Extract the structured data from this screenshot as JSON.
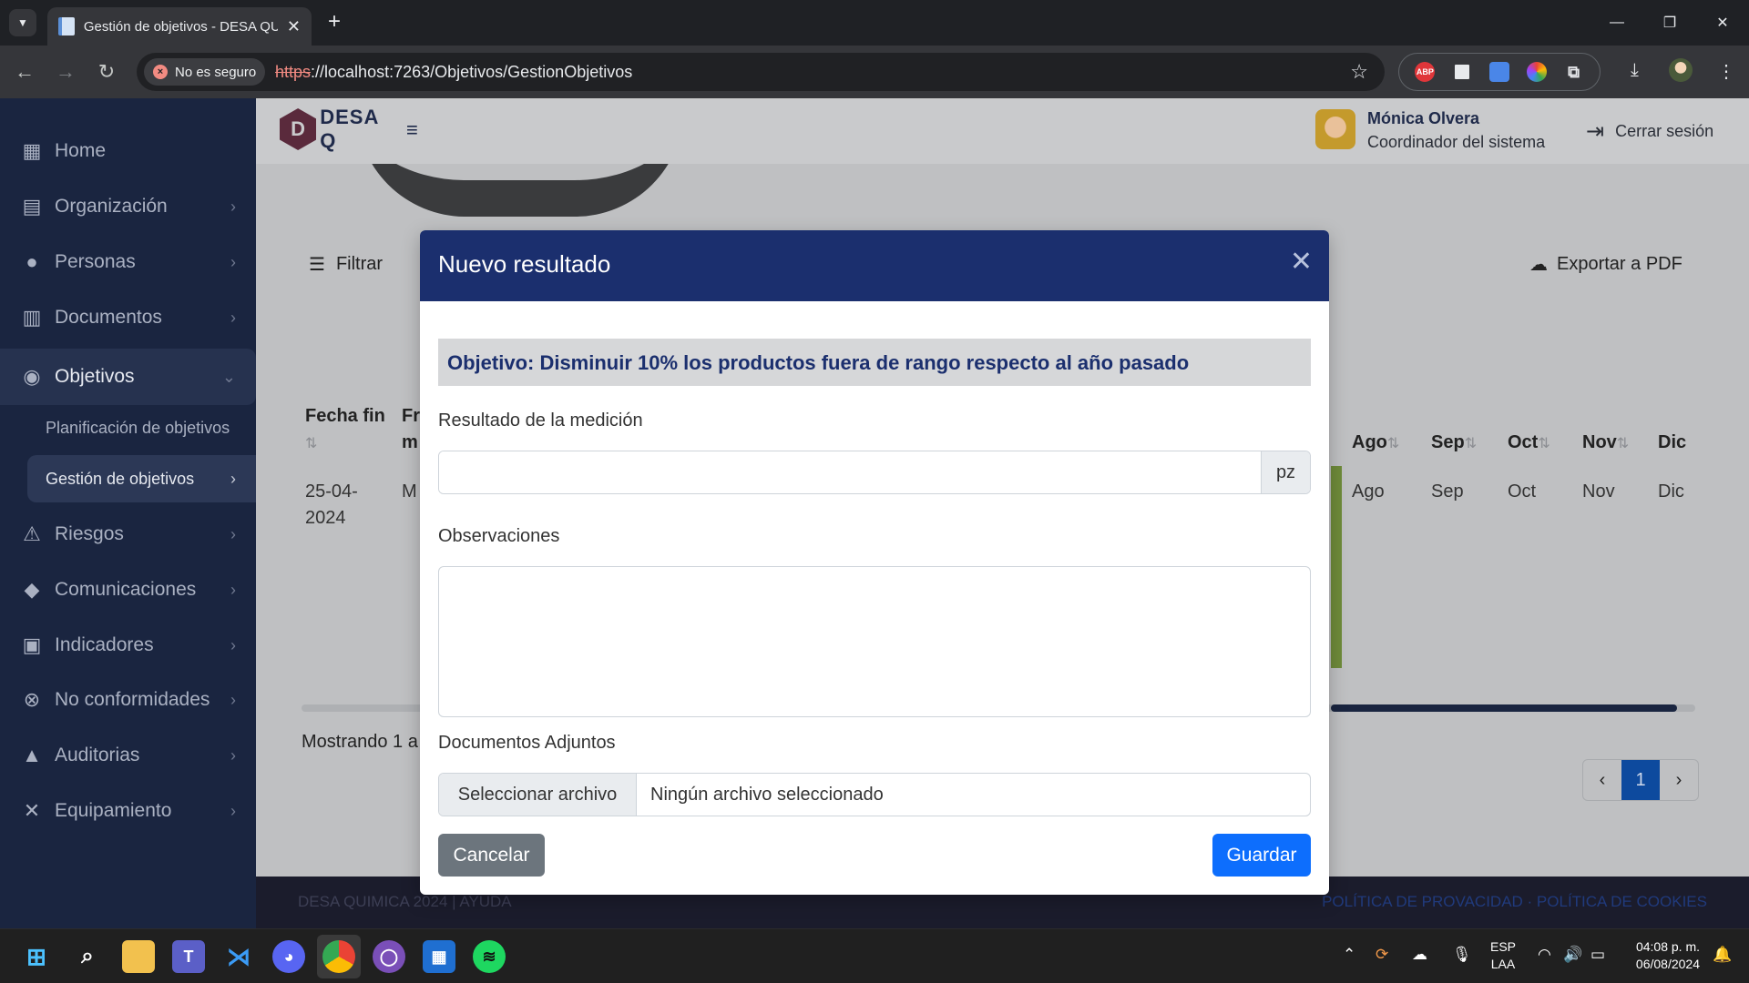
{
  "browser": {
    "tab_title": "Gestión de objetivos - DESA QU",
    "security_chip": "No es seguro",
    "url_scheme": "https",
    "url_rest": "://localhost:7263/Objetivos/GestionObjetivos",
    "extensions": [
      "ABP",
      "reader",
      "docs",
      "color",
      "puzzle"
    ]
  },
  "sidebar": {
    "items": [
      {
        "label": "Home",
        "icon": "dashboard-icon"
      },
      {
        "label": "Organización",
        "icon": "building-icon"
      },
      {
        "label": "Personas",
        "icon": "person-icon"
      },
      {
        "label": "Documentos",
        "icon": "book-icon"
      },
      {
        "label": "Objetivos",
        "icon": "target-icon"
      },
      {
        "label": "Riesgos",
        "icon": "warning-icon"
      },
      {
        "label": "Comunicaciones",
        "icon": "chat-icon"
      },
      {
        "label": "Indicadores",
        "icon": "indicator-icon"
      },
      {
        "label": "No conformidades",
        "icon": "x-circle-icon"
      },
      {
        "label": "Auditorias",
        "icon": "bell-icon"
      },
      {
        "label": "Equipamiento",
        "icon": "tools-icon"
      }
    ],
    "subitems": [
      {
        "label": "Planificación de objetivos"
      },
      {
        "label": "Gestión de objetivos"
      }
    ]
  },
  "header": {
    "logo_text": "DESA Q",
    "user_name": "Mónica Olvera",
    "user_role": "Coordinador del sistema",
    "logout_label": "Cerrar sesión"
  },
  "main": {
    "filter_label": "Filtrar",
    "export_label": "Exportar a PDF",
    "columns_left": [
      "Fecha fin",
      "Fr m"
    ],
    "columns_right": [
      "Ago",
      "Sep",
      "Oct",
      "Nov",
      "Dic"
    ],
    "row": {
      "fecha_fin": "25-04-2024",
      "fr": "M",
      "months": [
        "Ago",
        "Sep",
        "Oct",
        "Nov",
        "Dic"
      ]
    },
    "showing": "Mostrando 1 a",
    "page_current": "1",
    "footer_left": "DESA QUIMICA 2024 | AYUDA",
    "footer_right": "POLÍTICA DE PROVACIDAD · POLÍTICA DE COOKIES"
  },
  "modal": {
    "title": "Nuevo resultado",
    "objective": "Objetivo: Disminuir 10% los productos fuera de rango respecto al año pasado",
    "result_label": "Resultado de la medición",
    "result_value": "",
    "result_unit": "pz",
    "observations_label": "Observaciones",
    "observations_value": "",
    "attachments_label": "Documentos Adjuntos",
    "file_button": "Seleccionar archivo",
    "file_status": "Ningún archivo seleccionado",
    "cancel_label": "Cancelar",
    "save_label": "Guardar"
  },
  "taskbar": {
    "lang_line1": "ESP",
    "lang_line2": "LAA",
    "time": "04:08 p. m.",
    "date": "06/08/2024"
  }
}
